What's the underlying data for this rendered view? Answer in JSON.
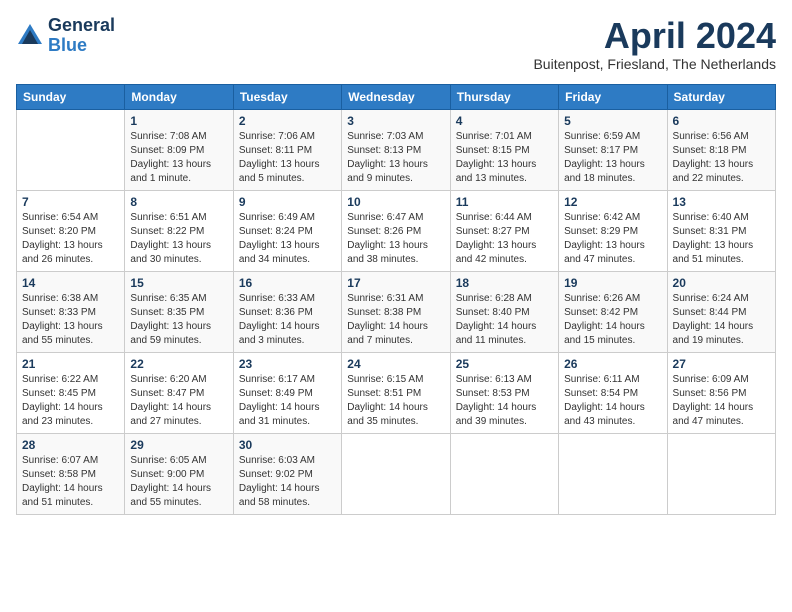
{
  "header": {
    "logo_general": "General",
    "logo_blue": "Blue",
    "month": "April 2024",
    "location": "Buitenpost, Friesland, The Netherlands"
  },
  "weekdays": [
    "Sunday",
    "Monday",
    "Tuesday",
    "Wednesday",
    "Thursday",
    "Friday",
    "Saturday"
  ],
  "weeks": [
    [
      {
        "day": "",
        "info": ""
      },
      {
        "day": "1",
        "info": "Sunrise: 7:08 AM\nSunset: 8:09 PM\nDaylight: 13 hours\nand 1 minute."
      },
      {
        "day": "2",
        "info": "Sunrise: 7:06 AM\nSunset: 8:11 PM\nDaylight: 13 hours\nand 5 minutes."
      },
      {
        "day": "3",
        "info": "Sunrise: 7:03 AM\nSunset: 8:13 PM\nDaylight: 13 hours\nand 9 minutes."
      },
      {
        "day": "4",
        "info": "Sunrise: 7:01 AM\nSunset: 8:15 PM\nDaylight: 13 hours\nand 13 minutes."
      },
      {
        "day": "5",
        "info": "Sunrise: 6:59 AM\nSunset: 8:17 PM\nDaylight: 13 hours\nand 18 minutes."
      },
      {
        "day": "6",
        "info": "Sunrise: 6:56 AM\nSunset: 8:18 PM\nDaylight: 13 hours\nand 22 minutes."
      }
    ],
    [
      {
        "day": "7",
        "info": "Sunrise: 6:54 AM\nSunset: 8:20 PM\nDaylight: 13 hours\nand 26 minutes."
      },
      {
        "day": "8",
        "info": "Sunrise: 6:51 AM\nSunset: 8:22 PM\nDaylight: 13 hours\nand 30 minutes."
      },
      {
        "day": "9",
        "info": "Sunrise: 6:49 AM\nSunset: 8:24 PM\nDaylight: 13 hours\nand 34 minutes."
      },
      {
        "day": "10",
        "info": "Sunrise: 6:47 AM\nSunset: 8:26 PM\nDaylight: 13 hours\nand 38 minutes."
      },
      {
        "day": "11",
        "info": "Sunrise: 6:44 AM\nSunset: 8:27 PM\nDaylight: 13 hours\nand 42 minutes."
      },
      {
        "day": "12",
        "info": "Sunrise: 6:42 AM\nSunset: 8:29 PM\nDaylight: 13 hours\nand 47 minutes."
      },
      {
        "day": "13",
        "info": "Sunrise: 6:40 AM\nSunset: 8:31 PM\nDaylight: 13 hours\nand 51 minutes."
      }
    ],
    [
      {
        "day": "14",
        "info": "Sunrise: 6:38 AM\nSunset: 8:33 PM\nDaylight: 13 hours\nand 55 minutes."
      },
      {
        "day": "15",
        "info": "Sunrise: 6:35 AM\nSunset: 8:35 PM\nDaylight: 13 hours\nand 59 minutes."
      },
      {
        "day": "16",
        "info": "Sunrise: 6:33 AM\nSunset: 8:36 PM\nDaylight: 14 hours\nand 3 minutes."
      },
      {
        "day": "17",
        "info": "Sunrise: 6:31 AM\nSunset: 8:38 PM\nDaylight: 14 hours\nand 7 minutes."
      },
      {
        "day": "18",
        "info": "Sunrise: 6:28 AM\nSunset: 8:40 PM\nDaylight: 14 hours\nand 11 minutes."
      },
      {
        "day": "19",
        "info": "Sunrise: 6:26 AM\nSunset: 8:42 PM\nDaylight: 14 hours\nand 15 minutes."
      },
      {
        "day": "20",
        "info": "Sunrise: 6:24 AM\nSunset: 8:44 PM\nDaylight: 14 hours\nand 19 minutes."
      }
    ],
    [
      {
        "day": "21",
        "info": "Sunrise: 6:22 AM\nSunset: 8:45 PM\nDaylight: 14 hours\nand 23 minutes."
      },
      {
        "day": "22",
        "info": "Sunrise: 6:20 AM\nSunset: 8:47 PM\nDaylight: 14 hours\nand 27 minutes."
      },
      {
        "day": "23",
        "info": "Sunrise: 6:17 AM\nSunset: 8:49 PM\nDaylight: 14 hours\nand 31 minutes."
      },
      {
        "day": "24",
        "info": "Sunrise: 6:15 AM\nSunset: 8:51 PM\nDaylight: 14 hours\nand 35 minutes."
      },
      {
        "day": "25",
        "info": "Sunrise: 6:13 AM\nSunset: 8:53 PM\nDaylight: 14 hours\nand 39 minutes."
      },
      {
        "day": "26",
        "info": "Sunrise: 6:11 AM\nSunset: 8:54 PM\nDaylight: 14 hours\nand 43 minutes."
      },
      {
        "day": "27",
        "info": "Sunrise: 6:09 AM\nSunset: 8:56 PM\nDaylight: 14 hours\nand 47 minutes."
      }
    ],
    [
      {
        "day": "28",
        "info": "Sunrise: 6:07 AM\nSunset: 8:58 PM\nDaylight: 14 hours\nand 51 minutes."
      },
      {
        "day": "29",
        "info": "Sunrise: 6:05 AM\nSunset: 9:00 PM\nDaylight: 14 hours\nand 55 minutes."
      },
      {
        "day": "30",
        "info": "Sunrise: 6:03 AM\nSunset: 9:02 PM\nDaylight: 14 hours\nand 58 minutes."
      },
      {
        "day": "",
        "info": ""
      },
      {
        "day": "",
        "info": ""
      },
      {
        "day": "",
        "info": ""
      },
      {
        "day": "",
        "info": ""
      }
    ]
  ]
}
